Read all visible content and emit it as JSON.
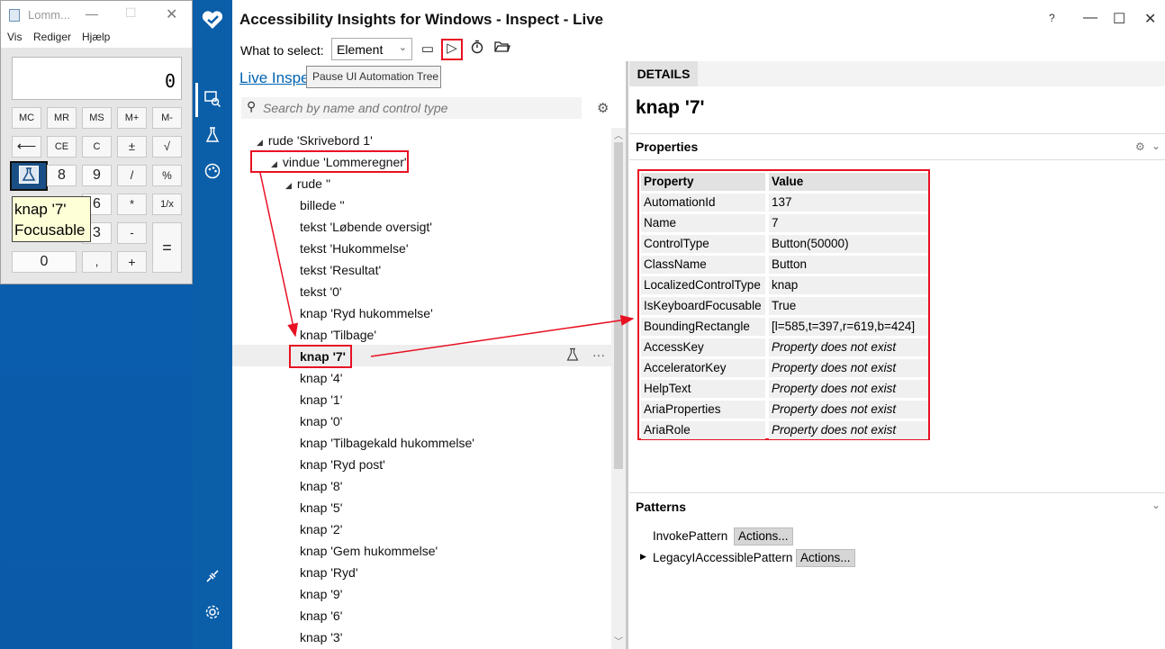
{
  "calculator": {
    "title": "Lomm...",
    "menus": [
      "Vis",
      "Rediger",
      "Hjælp"
    ],
    "display": "0",
    "memory_keys": [
      "MC",
      "MR",
      "MS",
      "M+",
      "M-"
    ],
    "keys_row2": [
      "⟵",
      "CE",
      "C",
      "±",
      "√"
    ],
    "keys_row3": [
      "8",
      "9",
      "/",
      "%"
    ],
    "keys_row4": [
      "6",
      "*",
      "1/x"
    ],
    "keys_row5": [
      "3",
      "-"
    ],
    "key_equals": "=",
    "key_zero": "0",
    "key_comma": ",",
    "key_plus": "+",
    "tooltip_line1": "knap '7'",
    "tooltip_line2": "Focusable"
  },
  "app": {
    "title": "Accessibility Insights for Windows - Inspect - Live",
    "select_label": "What to select:",
    "select_value": "Element",
    "pause_tooltip": "Pause UI Automation Tree",
    "live_link": "Live Inspe",
    "search_placeholder": "Search by name and control type"
  },
  "tree": [
    {
      "label": "rude 'Skrivebord 1'",
      "level": 0,
      "expander": "◢"
    },
    {
      "label": "vindue 'Lommeregner'",
      "level": 1,
      "expander": "◢"
    },
    {
      "label": "rude ''",
      "level": 2,
      "expander": "◢"
    },
    {
      "label": "billede ''",
      "level": 3
    },
    {
      "label": "tekst 'Løbende oversigt'",
      "level": 3
    },
    {
      "label": "tekst 'Hukommelse'",
      "level": 3
    },
    {
      "label": "tekst 'Resultat'",
      "level": 3
    },
    {
      "label": "tekst '0'",
      "level": 3
    },
    {
      "label": "knap 'Ryd hukommelse'",
      "level": 3
    },
    {
      "label": "knap 'Tilbage'",
      "level": 3
    },
    {
      "label": "knap '7'",
      "level": 3,
      "selected": true
    },
    {
      "label": "knap '4'",
      "level": 3
    },
    {
      "label": "knap '1'",
      "level": 3
    },
    {
      "label": "knap '0'",
      "level": 3
    },
    {
      "label": "knap 'Tilbagekald hukommelse'",
      "level": 3
    },
    {
      "label": "knap 'Ryd post'",
      "level": 3
    },
    {
      "label": "knap '8'",
      "level": 3
    },
    {
      "label": "knap '5'",
      "level": 3
    },
    {
      "label": "knap '2'",
      "level": 3
    },
    {
      "label": "knap 'Gem hukommelse'",
      "level": 3
    },
    {
      "label": "knap 'Ryd'",
      "level": 3
    },
    {
      "label": "knap '9'",
      "level": 3
    },
    {
      "label": "knap '6'",
      "level": 3
    },
    {
      "label": "knap '3'",
      "level": 3
    }
  ],
  "details": {
    "tab": "DETAILS",
    "title": "knap '7'",
    "properties_label": "Properties",
    "table_header": {
      "name": "Property",
      "value": "Value"
    },
    "properties": [
      {
        "name": "AutomationId",
        "value": "137",
        "missing": false
      },
      {
        "name": "Name",
        "value": "7",
        "missing": false
      },
      {
        "name": "ControlType",
        "value": "Button(50000)",
        "missing": false
      },
      {
        "name": "ClassName",
        "value": "Button",
        "missing": false
      },
      {
        "name": "LocalizedControlType",
        "value": "knap",
        "missing": false
      },
      {
        "name": "IsKeyboardFocusable",
        "value": "True",
        "missing": false
      },
      {
        "name": "BoundingRectangle",
        "value": "[l=585,t=397,r=619,b=424]",
        "missing": false
      },
      {
        "name": "AccessKey",
        "value": "Property does not exist",
        "missing": true
      },
      {
        "name": "AcceleratorKey",
        "value": "Property does not exist",
        "missing": true
      },
      {
        "name": "HelpText",
        "value": "Property does not exist",
        "missing": true
      },
      {
        "name": "AriaProperties",
        "value": "Property does not exist",
        "missing": true
      },
      {
        "name": "AriaRole",
        "value": "Property does not exist",
        "missing": true
      }
    ],
    "patterns_label": "Patterns",
    "patterns": [
      {
        "name": "InvokePattern",
        "action": "Actions...",
        "expander": false
      },
      {
        "name": "LegacyIAccessiblePattern",
        "action": "Actions...",
        "expander": true
      }
    ]
  },
  "colors": {
    "accent": "#0063b1",
    "highlight": "#e81123",
    "rail": "#0b5ea8"
  }
}
